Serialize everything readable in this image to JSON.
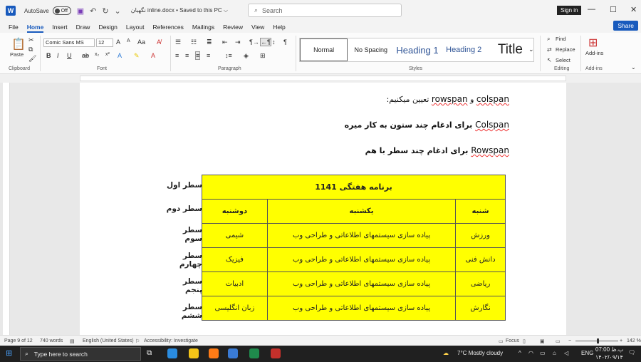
{
  "titlebar": {
    "autosave_label": "AutoSave",
    "toggle_state": "Off",
    "doc_title": "نگهبان inline.docx • Saved to this PC ⌵",
    "search_placeholder": "Search",
    "signin": "Sign in"
  },
  "menu": {
    "tabs": [
      "File",
      "Home",
      "Insert",
      "Draw",
      "Design",
      "Layout",
      "References",
      "Mailings",
      "Review",
      "View",
      "Help"
    ],
    "active": "Home",
    "share": "Share"
  },
  "ribbon": {
    "paste": "Paste",
    "clipboard": "Clipboard",
    "font_name": "Comic Sans MS",
    "font_size": "12",
    "font_group": "Font",
    "paragraph_group": "Paragraph",
    "styles_group": "Styles",
    "styles": [
      "Normal",
      "No Spacing",
      "Heading 1",
      "Heading 2",
      "Title"
    ],
    "find": "Find",
    "replace": "Replace",
    "select": "Select",
    "editing_group": "Editing",
    "addins": "Add-ins",
    "addins_group": "Add-ins"
  },
  "document": {
    "line1_latin_a": "colspan",
    "line1_mid": "و",
    "line1_latin_b": "rowspan",
    "line1_rest": "تعیین میکنیم:",
    "line2_latin": "Colspan",
    "line2_rest": "برای ادغام چند ستون به کار میره",
    "line3_latin": "Rowspan",
    "line3_rest": "برای ادغام چند سطر با هم",
    "row_labels": [
      "سطر اول",
      "سطر دوم",
      "سطر سوم",
      "سطر چهارم",
      "سطر پنجم",
      "سطر ششم"
    ],
    "table": {
      "title": "برنامه هفتگی 1141",
      "headers": [
        "شنبه",
        "یکشنبه",
        "دوشنبه"
      ],
      "rows": [
        [
          "ورزش",
          "پیاده سازی سیستمهای اطلاعاتی و طراحی وب",
          "شیمی"
        ],
        [
          "دانش فنی",
          "پیاده سازی سیستمهای اطلاعاتی و طراحی وب",
          "فیزیک"
        ],
        [
          "ریاضی",
          "پیاده سازی سیستمهای اطلاعاتی و طراحی وب",
          "ادبیات"
        ],
        [
          "نگارش",
          "پیاده سازی سیستمهای اطلاعاتی و طراحی وب",
          "زبان انگلیسی"
        ]
      ],
      "fill_color": "#ffff00"
    }
  },
  "status": {
    "page": "Page 9 of 12",
    "words": "740 words",
    "language": "English (United States)",
    "accessibility": "Accessibility: Investigate",
    "focus": "Focus",
    "zoom": "142 %"
  },
  "taskbar": {
    "search_placeholder": "Type here to search",
    "weather": "7°C  Mostly cloudy",
    "lang": "ENG",
    "time": "07:00 ب.ظ",
    "date": "۱۴۰۲/۰۹/۱۴"
  },
  "colors": {
    "accent": "#185abd",
    "table_fill": "#ffff00"
  }
}
